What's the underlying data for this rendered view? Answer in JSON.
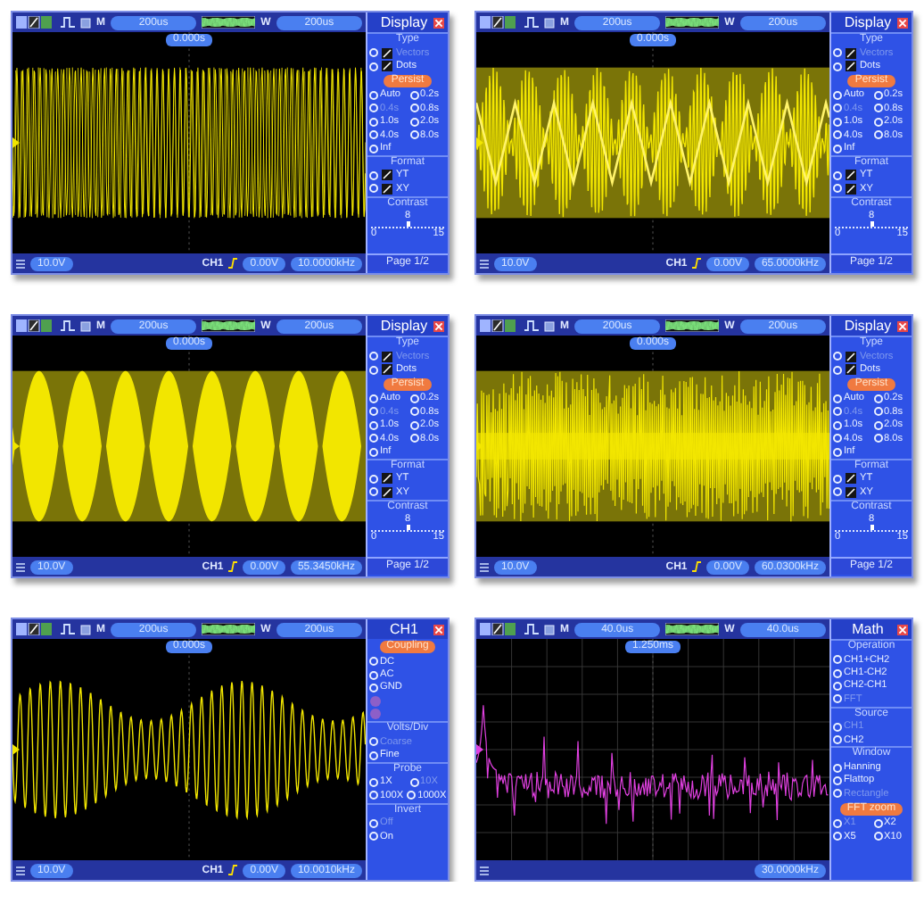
{
  "screens": [
    {
      "trace": {
        "kind": "dense",
        "color": "#f2e600"
      },
      "mode": "M",
      "timebase": "200us",
      "window_label": "W",
      "window": "200us",
      "trigger_position": "0.000s",
      "channel_scale": "10.0V",
      "trigger_source": "CH1",
      "trigger_level": "0.00V",
      "frequency": "10.0000kHz",
      "menu": {
        "title": "Display",
        "entries": [
          {
            "kind": "heading",
            "text": "Type"
          },
          {
            "kind": "check",
            "text": "Vectors",
            "disabled": true
          },
          {
            "kind": "check",
            "text": "Dots",
            "disabled": false
          },
          {
            "kind": "pill",
            "text": "Persist"
          },
          {
            "kind": "options",
            "items": [
              {
                "text": "Auto",
                "disabled": false
              },
              {
                "text": "0.2s",
                "disabled": false
              }
            ]
          },
          {
            "kind": "options",
            "items": [
              {
                "text": "0.4s",
                "disabled": true
              },
              {
                "text": "0.8s",
                "disabled": false
              }
            ]
          },
          {
            "kind": "options",
            "items": [
              {
                "text": "1.0s",
                "disabled": false
              },
              {
                "text": "2.0s",
                "disabled": false
              }
            ]
          },
          {
            "kind": "options",
            "items": [
              {
                "text": "4.0s",
                "disabled": false
              },
              {
                "text": "8.0s",
                "disabled": false
              }
            ]
          },
          {
            "kind": "options",
            "items": [
              {
                "text": "Inf",
                "disabled": false
              }
            ]
          },
          {
            "kind": "heading",
            "text": "Format"
          },
          {
            "kind": "check",
            "text": "YT",
            "disabled": false
          },
          {
            "kind": "check",
            "text": "XY",
            "disabled": false
          },
          {
            "kind": "heading",
            "text": "Contrast"
          },
          {
            "kind": "slider",
            "value": "8",
            "min": "0",
            "max": "15",
            "level": 0.5
          },
          {
            "kind": "page",
            "text": "Page 1/2"
          }
        ]
      }
    },
    {
      "trace": {
        "kind": "triangle",
        "color": "#f2e600"
      },
      "mode": "M",
      "timebase": "200us",
      "window_label": "W",
      "window": "200us",
      "trigger_position": "0.000s",
      "channel_scale": "10.0V",
      "trigger_source": "CH1",
      "trigger_level": "0.00V",
      "frequency": "65.0000kHz",
      "menu": {
        "title": "Display",
        "entries": [
          {
            "kind": "heading",
            "text": "Type"
          },
          {
            "kind": "check",
            "text": "Vectors",
            "disabled": true
          },
          {
            "kind": "check",
            "text": "Dots",
            "disabled": false
          },
          {
            "kind": "pill",
            "text": "Persist"
          },
          {
            "kind": "options",
            "items": [
              {
                "text": "Auto",
                "disabled": false
              },
              {
                "text": "0.2s",
                "disabled": false
              }
            ]
          },
          {
            "kind": "options",
            "items": [
              {
                "text": "0.4s",
                "disabled": true
              },
              {
                "text": "0.8s",
                "disabled": false
              }
            ]
          },
          {
            "kind": "options",
            "items": [
              {
                "text": "1.0s",
                "disabled": false
              },
              {
                "text": "2.0s",
                "disabled": false
              }
            ]
          },
          {
            "kind": "options",
            "items": [
              {
                "text": "4.0s",
                "disabled": false
              },
              {
                "text": "8.0s",
                "disabled": false
              }
            ]
          },
          {
            "kind": "options",
            "items": [
              {
                "text": "Inf",
                "disabled": false
              }
            ]
          },
          {
            "kind": "heading",
            "text": "Format"
          },
          {
            "kind": "check",
            "text": "YT",
            "disabled": false
          },
          {
            "kind": "check",
            "text": "XY",
            "disabled": false
          },
          {
            "kind": "heading",
            "text": "Contrast"
          },
          {
            "kind": "slider",
            "value": "8",
            "min": "0",
            "max": "15",
            "level": 0.5
          },
          {
            "kind": "page",
            "text": "Page 1/2"
          }
        ]
      }
    },
    {
      "trace": {
        "kind": "lobes",
        "color": "#f2e600"
      },
      "mode": "M",
      "timebase": "200us",
      "window_label": "W",
      "window": "200us",
      "trigger_position": "0.000s",
      "channel_scale": "10.0V",
      "trigger_source": "CH1",
      "trigger_level": "0.00V",
      "frequency": "55.3450kHz",
      "menu": {
        "title": "Display",
        "entries": [
          {
            "kind": "heading",
            "text": "Type"
          },
          {
            "kind": "check",
            "text": "Vectors",
            "disabled": true
          },
          {
            "kind": "check",
            "text": "Dots",
            "disabled": false
          },
          {
            "kind": "pill",
            "text": "Persist"
          },
          {
            "kind": "options",
            "items": [
              {
                "text": "Auto",
                "disabled": false
              },
              {
                "text": "0.2s",
                "disabled": false
              }
            ]
          },
          {
            "kind": "options",
            "items": [
              {
                "text": "0.4s",
                "disabled": true
              },
              {
                "text": "0.8s",
                "disabled": false
              }
            ]
          },
          {
            "kind": "options",
            "items": [
              {
                "text": "1.0s",
                "disabled": false
              },
              {
                "text": "2.0s",
                "disabled": false
              }
            ]
          },
          {
            "kind": "options",
            "items": [
              {
                "text": "4.0s",
                "disabled": false
              },
              {
                "text": "8.0s",
                "disabled": false
              }
            ]
          },
          {
            "kind": "options",
            "items": [
              {
                "text": "Inf",
                "disabled": false
              }
            ]
          },
          {
            "kind": "heading",
            "text": "Format"
          },
          {
            "kind": "check",
            "text": "YT",
            "disabled": false
          },
          {
            "kind": "check",
            "text": "XY",
            "disabled": false
          },
          {
            "kind": "heading",
            "text": "Contrast"
          },
          {
            "kind": "slider",
            "value": "8",
            "min": "0",
            "max": "15",
            "level": 0.5
          },
          {
            "kind": "page",
            "text": "Page 1/2"
          }
        ]
      }
    },
    {
      "trace": {
        "kind": "noise",
        "color": "#f2e600"
      },
      "mode": "M",
      "timebase": "200us",
      "window_label": "W",
      "window": "200us",
      "trigger_position": "0.000s",
      "channel_scale": "10.0V",
      "trigger_source": "CH1",
      "trigger_level": "0.00V",
      "frequency": "60.0300kHz",
      "menu": {
        "title": "Display",
        "entries": [
          {
            "kind": "heading",
            "text": "Type"
          },
          {
            "kind": "check",
            "text": "Vectors",
            "disabled": true
          },
          {
            "kind": "check",
            "text": "Dots",
            "disabled": false
          },
          {
            "kind": "pill",
            "text": "Persist"
          },
          {
            "kind": "options",
            "items": [
              {
                "text": "Auto",
                "disabled": false
              },
              {
                "text": "0.2s",
                "disabled": false
              }
            ]
          },
          {
            "kind": "options",
            "items": [
              {
                "text": "0.4s",
                "disabled": true
              },
              {
                "text": "0.8s",
                "disabled": false
              }
            ]
          },
          {
            "kind": "options",
            "items": [
              {
                "text": "1.0s",
                "disabled": false
              },
              {
                "text": "2.0s",
                "disabled": false
              }
            ]
          },
          {
            "kind": "options",
            "items": [
              {
                "text": "4.0s",
                "disabled": false
              },
              {
                "text": "8.0s",
                "disabled": false
              }
            ]
          },
          {
            "kind": "options",
            "items": [
              {
                "text": "Inf",
                "disabled": false
              }
            ]
          },
          {
            "kind": "heading",
            "text": "Format"
          },
          {
            "kind": "check",
            "text": "YT",
            "disabled": false
          },
          {
            "kind": "check",
            "text": "XY",
            "disabled": false
          },
          {
            "kind": "heading",
            "text": "Contrast"
          },
          {
            "kind": "slider",
            "value": "8",
            "min": "0",
            "max": "15",
            "level": 0.5
          },
          {
            "kind": "page",
            "text": "Page 1/2"
          }
        ]
      }
    },
    {
      "trace": {
        "kind": "am",
        "color": "#f2e600"
      },
      "mode": "M",
      "timebase": "200us",
      "window_label": "W",
      "window": "200us",
      "trigger_position": "0.000s",
      "channel_scale": "10.0V",
      "trigger_source": "CH1",
      "trigger_level": "0.00V",
      "frequency": "10.0010kHz",
      "menu": {
        "title": "CH1",
        "entries": [
          {
            "kind": "pill",
            "text": "Coupling"
          },
          {
            "kind": "options",
            "items": [
              {
                "text": "DC",
                "disabled": false
              }
            ]
          },
          {
            "kind": "options",
            "items": [
              {
                "text": "AC",
                "disabled": false
              }
            ]
          },
          {
            "kind": "options",
            "items": [
              {
                "text": "GND",
                "disabled": false
              }
            ]
          },
          {
            "kind": "icon_row"
          },
          {
            "kind": "icon_row"
          },
          {
            "kind": "heading",
            "text": "Volts/Div"
          },
          {
            "kind": "options",
            "items": [
              {
                "text": "Coarse",
                "disabled": true
              }
            ]
          },
          {
            "kind": "options",
            "items": [
              {
                "text": "Fine",
                "disabled": false
              }
            ]
          },
          {
            "kind": "heading",
            "text": "Probe"
          },
          {
            "kind": "options",
            "items": [
              {
                "text": "1X",
                "disabled": false
              },
              {
                "text": "10X",
                "disabled": true
              }
            ]
          },
          {
            "kind": "options",
            "items": [
              {
                "text": "100X",
                "disabled": false
              },
              {
                "text": "1000X",
                "disabled": false
              }
            ]
          },
          {
            "kind": "heading",
            "text": "Invert"
          },
          {
            "kind": "options",
            "items": [
              {
                "text": "Off",
                "disabled": true
              }
            ]
          },
          {
            "kind": "options",
            "items": [
              {
                "text": "On",
                "disabled": false
              }
            ]
          }
        ]
      }
    },
    {
      "trace": {
        "kind": "spectrum",
        "color": "#e040e0"
      },
      "mode": "M",
      "timebase": "40.0us",
      "window_label": "W",
      "window": "40.0us",
      "trigger_position": "1.250ms",
      "frequency": "30.0000kHz",
      "menu": {
        "title": "Math",
        "entries": [
          {
            "kind": "heading",
            "text": "Operation"
          },
          {
            "kind": "options",
            "items": [
              {
                "text": "CH1+CH2",
                "disabled": false
              }
            ]
          },
          {
            "kind": "options",
            "items": [
              {
                "text": "CH1-CH2",
                "disabled": false
              }
            ]
          },
          {
            "kind": "options",
            "items": [
              {
                "text": "CH2-CH1",
                "disabled": false
              }
            ]
          },
          {
            "kind": "options",
            "items": [
              {
                "text": "FFT",
                "disabled": true
              }
            ]
          },
          {
            "kind": "heading",
            "text": "Source"
          },
          {
            "kind": "options",
            "items": [
              {
                "text": "CH1",
                "disabled": true
              }
            ]
          },
          {
            "kind": "options",
            "items": [
              {
                "text": "CH2",
                "disabled": false
              }
            ]
          },
          {
            "kind": "heading",
            "text": "Window"
          },
          {
            "kind": "options",
            "items": [
              {
                "text": "Hanning",
                "disabled": false
              }
            ]
          },
          {
            "kind": "options",
            "items": [
              {
                "text": "Flattop",
                "disabled": false
              }
            ]
          },
          {
            "kind": "options",
            "items": [
              {
                "text": "Rectangle",
                "disabled": true
              }
            ]
          },
          {
            "kind": "pill",
            "text": "FFT zoom"
          },
          {
            "kind": "options",
            "items": [
              {
                "text": "X1",
                "disabled": true
              },
              {
                "text": "X2",
                "disabled": false
              }
            ]
          },
          {
            "kind": "options",
            "items": [
              {
                "text": "X5",
                "disabled": false
              },
              {
                "text": "X10",
                "disabled": false
              }
            ]
          }
        ]
      }
    }
  ]
}
